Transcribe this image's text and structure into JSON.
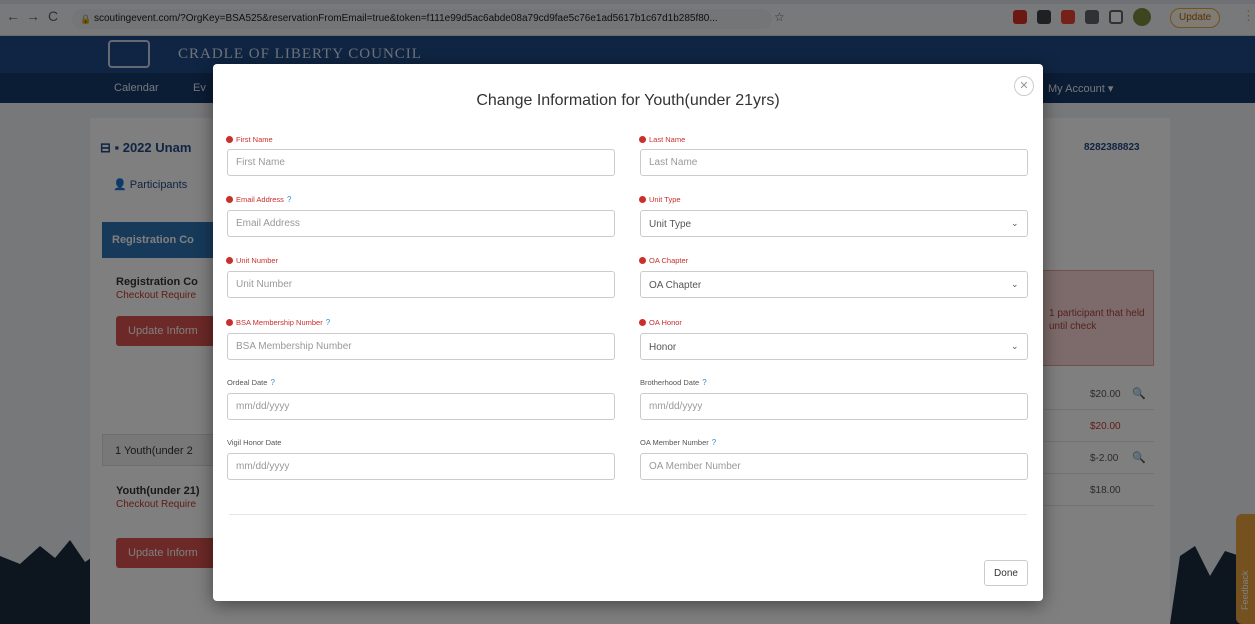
{
  "browser": {
    "back_icon": "←",
    "forward_icon": "→",
    "reload_icon": "C",
    "lock_icon": "🔒",
    "url": "scoutingevent.com/?OrgKey=BSA525&reservationFromEmail=true&token=f111e99d5ac6abde08a79cd9fae5c76e1ad5617b1c67d1b285f80...",
    "star_icon": "☆",
    "update_label": "Update",
    "menu_icon": "⋮",
    "colors": {
      "accent": "#e8a33d"
    }
  },
  "site": {
    "title": "CRADLE OF LIBERTY COUNCIL",
    "nav": {
      "calendar": "Calendar",
      "events": "Ev",
      "account": "My Account ▾"
    },
    "event_title": "⊟ ▪ 2022 Unam",
    "reservation_code": "8282388823",
    "participants_tab": "👤 Participants",
    "registration_panel": {
      "header": "Registration Co",
      "title": "Registration Co",
      "checkout": "Checkout Require",
      "update_button": "Update Inform"
    },
    "youth_panel": {
      "header": "1 Youth(under 2",
      "title": "Youth(under 21)",
      "checkout": "Checkout Require",
      "update_button": "Update Inform"
    },
    "warning_text": "1 participant that held until check",
    "prices": [
      {
        "value": "$20.00",
        "zoom": "🔍"
      },
      {
        "value": "$20.00",
        "zoom": ""
      },
      {
        "value": "$-2.00",
        "zoom": "🔍"
      },
      {
        "value": "$18.00",
        "zoom": ""
      }
    ],
    "feedback_label": "Feedback",
    "colors": {
      "brand": "#1f4b86",
      "danger": "#d9534f"
    }
  },
  "modal": {
    "title": "Change Information for Youth(under 21yrs)",
    "close_icon": "✕",
    "fields": {
      "first_name": {
        "label": "First Name",
        "placeholder": "First Name"
      },
      "last_name": {
        "label": "Last Name",
        "placeholder": "Last Name"
      },
      "email": {
        "label": "Email Address",
        "placeholder": "Email Address",
        "help": "?"
      },
      "unit_type": {
        "label": "Unit Type",
        "value": "Unit Type"
      },
      "unit_number": {
        "label": "Unit Number",
        "placeholder": "Unit Number"
      },
      "oa_chapter": {
        "label": "OA Chapter",
        "value": "OA Chapter"
      },
      "bsa_number": {
        "label": "BSA Membership Number",
        "placeholder": "BSA Membership Number",
        "help": "?"
      },
      "oa_honor": {
        "label": "OA Honor",
        "value": "Honor"
      },
      "ordeal_date": {
        "label": "Ordeal Date",
        "placeholder": "mm/dd/yyyy",
        "help": "?"
      },
      "brotherhood_date": {
        "label": "Brotherhood Date",
        "placeholder": "mm/dd/yyyy",
        "help": "?"
      },
      "vigil_date": {
        "label": "Vigil Honor Date",
        "placeholder": "mm/dd/yyyy"
      },
      "oa_member_number": {
        "label": "OA Member Number",
        "placeholder": "OA Member Number",
        "help": "?"
      }
    },
    "chevron_icon": "⌄",
    "done_label": "Done",
    "colors": {
      "required": "#c9302c",
      "help": "#2e8bd8"
    }
  }
}
